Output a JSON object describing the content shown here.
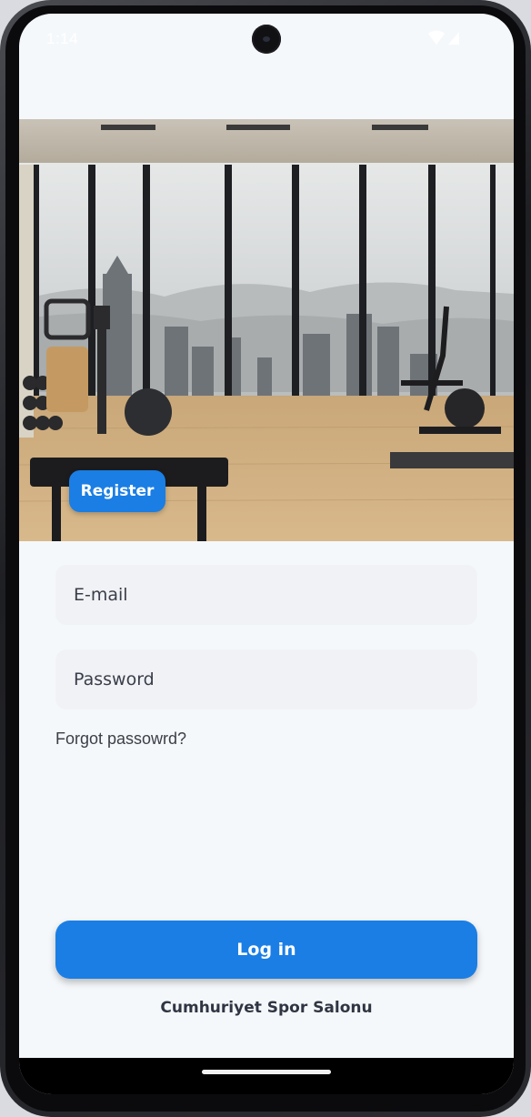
{
  "status_bar": {
    "time": "1:14",
    "icons": [
      "wifi-icon",
      "signal-icon"
    ]
  },
  "hero": {
    "image_subject": "modern gym interior with floor-to-ceiling windows and city skyline",
    "register_label": "Register"
  },
  "form": {
    "email_placeholder": "E-mail",
    "password_placeholder": "Password",
    "forgot_label": "Forgot passowrd?"
  },
  "actions": {
    "login_label": "Log in"
  },
  "footer": {
    "gym_name": "Cumhuriyet Spor Salonu"
  },
  "colors": {
    "accent": "#1a7ee5",
    "background": "#f5f8fb",
    "field": "#f1f2f5",
    "text": "#2f3542"
  }
}
